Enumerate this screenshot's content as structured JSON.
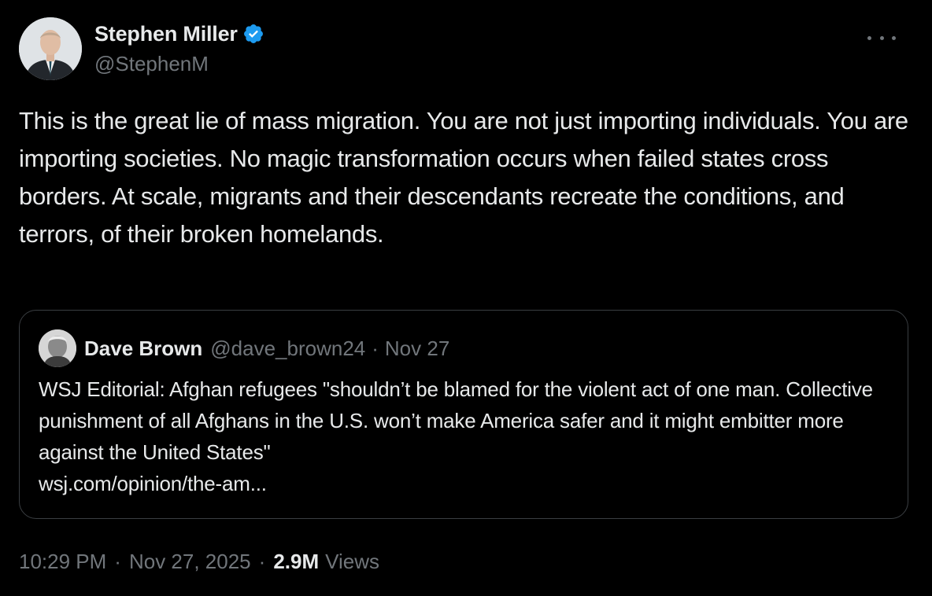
{
  "author": {
    "display_name": "Stephen Miller",
    "handle": "@StephenM",
    "verified": true,
    "avatar_icon": "person-suit-avatar"
  },
  "tweet": {
    "text": "This is the great lie of mass migration. You are not just importing individuals. You are importing societies. No magic transformation occurs when failed states cross borders. At scale, migrants and their descendants recreate the conditions, and terrors, of their broken homelands."
  },
  "quoted_tweet": {
    "display_name": "Dave Brown",
    "handle": "@dave_brown24",
    "separator": "·",
    "date": "Nov 27",
    "text": "WSJ Editorial: Afghan refugees \"shouldn’t be blamed for the violent act of one man. Collective punishment of all Afghans in the U.S. won’t make America safer and it might embitter more against the United States\"",
    "link": "wsj.com/opinion/the-am..."
  },
  "meta": {
    "time": "10:29 PM",
    "date": "Nov 27, 2025",
    "separator": "·",
    "views_count": "2.9M",
    "views_label": "Views"
  },
  "colors": {
    "background": "#000000",
    "text_primary": "#e7e9ea",
    "text_secondary": "#71767b",
    "verified_badge": "#1d9bf0",
    "quote_border": "#3a3e42"
  }
}
